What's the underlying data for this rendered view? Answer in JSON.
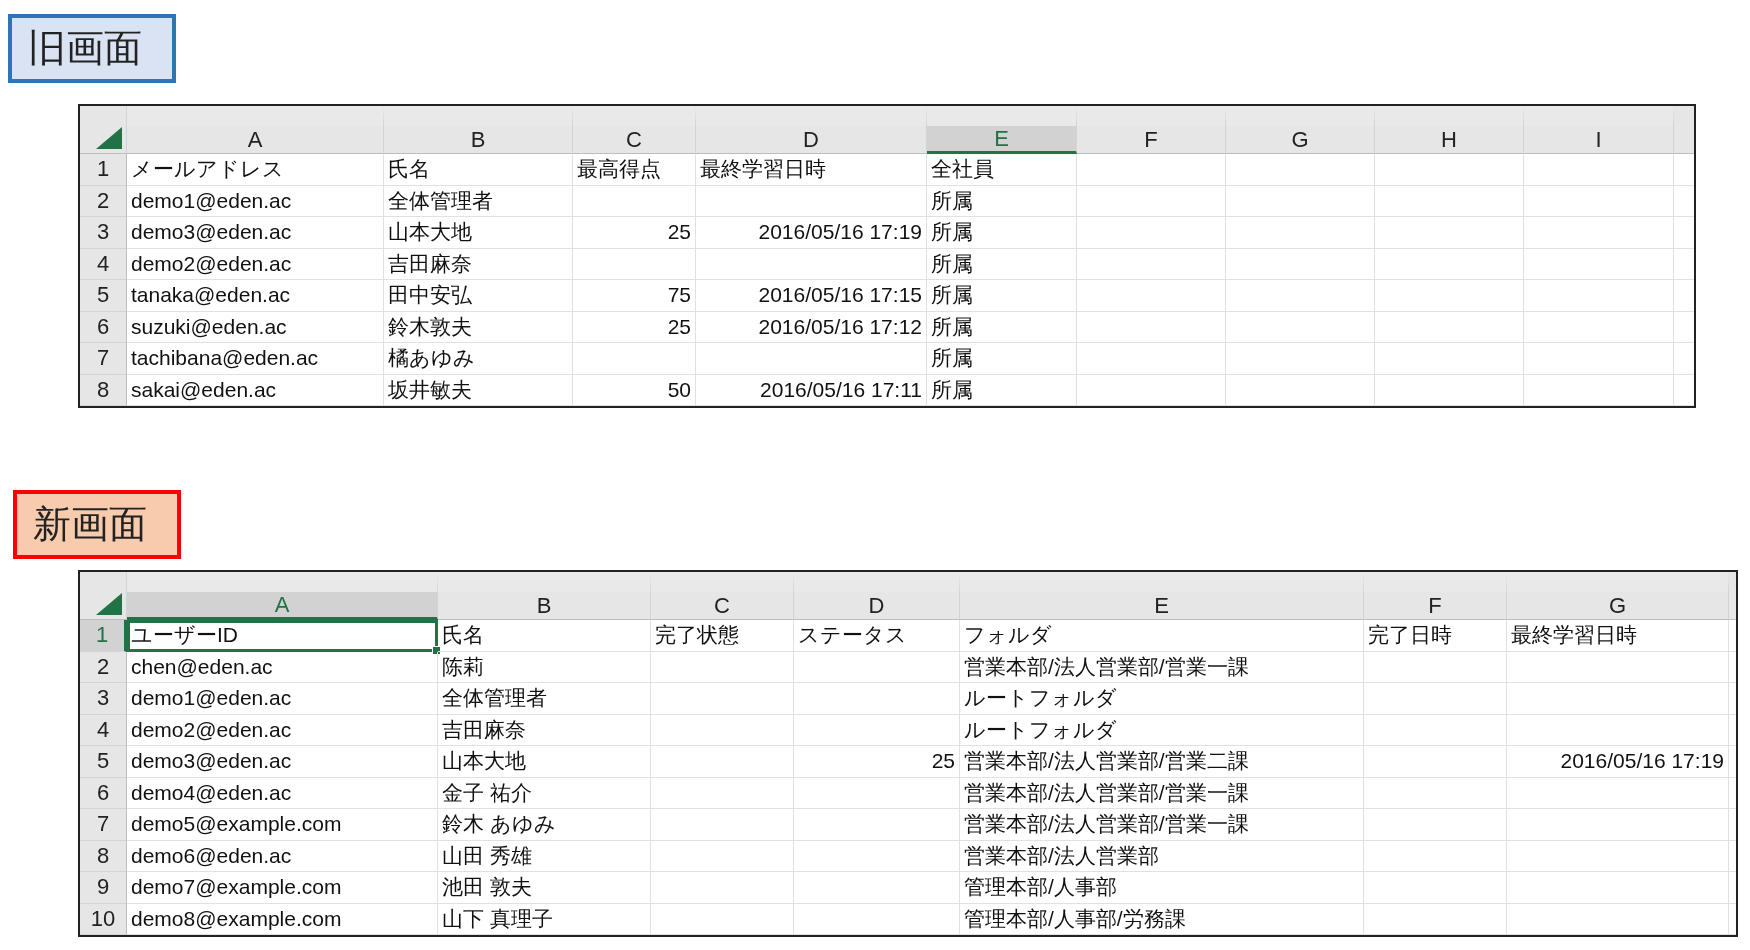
{
  "sheets": [
    {
      "label": "旧画面",
      "kind": "old",
      "columns": [
        {
          "letter": "A",
          "selected": false
        },
        {
          "letter": "B",
          "selected": false
        },
        {
          "letter": "C",
          "selected": false
        },
        {
          "letter": "D",
          "selected": false
        },
        {
          "letter": "E",
          "selected": true
        },
        {
          "letter": "F",
          "selected": false
        },
        {
          "letter": "G",
          "selected": false
        },
        {
          "letter": "H",
          "selected": false
        },
        {
          "letter": "I",
          "selected": false
        }
      ],
      "rows": [
        {
          "number": "1",
          "selected": false,
          "cells": [
            {
              "text": "メールアドレス",
              "kind": "text"
            },
            {
              "text": "氏名",
              "kind": "text"
            },
            {
              "text": "最高得点",
              "kind": "text"
            },
            {
              "text": "最終学習日時",
              "kind": "text"
            },
            {
              "text": "全社員",
              "kind": "text"
            },
            null,
            null,
            null,
            null
          ]
        },
        {
          "number": "2",
          "selected": false,
          "cells": [
            {
              "text": "demo1@eden.ac",
              "kind": "text"
            },
            {
              "text": "全体管理者",
              "kind": "text"
            },
            null,
            null,
            {
              "text": "所属",
              "kind": "text"
            },
            null,
            null,
            null,
            null
          ]
        },
        {
          "number": "3",
          "selected": false,
          "cells": [
            {
              "text": "demo3@eden.ac",
              "kind": "text"
            },
            {
              "text": "山本大地",
              "kind": "text"
            },
            {
              "text": "25",
              "kind": "number"
            },
            {
              "text": "2016/05/16 17:19",
              "kind": "number"
            },
            {
              "text": "所属",
              "kind": "text"
            },
            null,
            null,
            null,
            null
          ]
        },
        {
          "number": "4",
          "selected": false,
          "cells": [
            {
              "text": "demo2@eden.ac",
              "kind": "text"
            },
            {
              "text": "吉田麻奈",
              "kind": "text"
            },
            null,
            null,
            {
              "text": "所属",
              "kind": "text"
            },
            null,
            null,
            null,
            null
          ]
        },
        {
          "number": "5",
          "selected": false,
          "cells": [
            {
              "text": "tanaka@eden.ac",
              "kind": "text"
            },
            {
              "text": "田中安弘",
              "kind": "text"
            },
            {
              "text": "75",
              "kind": "number"
            },
            {
              "text": "2016/05/16 17:15",
              "kind": "number"
            },
            {
              "text": "所属",
              "kind": "text"
            },
            null,
            null,
            null,
            null
          ]
        },
        {
          "number": "6",
          "selected": false,
          "cells": [
            {
              "text": "suzuki@eden.ac",
              "kind": "text"
            },
            {
              "text": "鈴木敦夫",
              "kind": "text"
            },
            {
              "text": "25",
              "kind": "number"
            },
            {
              "text": "2016/05/16 17:12",
              "kind": "number"
            },
            {
              "text": "所属",
              "kind": "text"
            },
            null,
            null,
            null,
            null
          ]
        },
        {
          "number": "7",
          "selected": false,
          "cells": [
            {
              "text": "tachibana@eden.ac",
              "kind": "text"
            },
            {
              "text": "橘あゆみ",
              "kind": "text"
            },
            null,
            null,
            {
              "text": "所属",
              "kind": "text"
            },
            null,
            null,
            null,
            null
          ]
        },
        {
          "number": "8",
          "selected": false,
          "cells": [
            {
              "text": "sakai@eden.ac",
              "kind": "text"
            },
            {
              "text": "坂井敏夫",
              "kind": "text"
            },
            {
              "text": "50",
              "kind": "number"
            },
            {
              "text": "2016/05/16 17:11",
              "kind": "number"
            },
            {
              "text": "所属",
              "kind": "text"
            },
            null,
            null,
            null,
            null
          ]
        }
      ]
    },
    {
      "label": "新画面",
      "kind": "new",
      "columns": [
        {
          "letter": "A",
          "selected": true
        },
        {
          "letter": "B",
          "selected": false
        },
        {
          "letter": "C",
          "selected": false
        },
        {
          "letter": "D",
          "selected": false
        },
        {
          "letter": "E",
          "selected": false
        },
        {
          "letter": "F",
          "selected": false
        },
        {
          "letter": "G",
          "selected": false
        }
      ],
      "rows": [
        {
          "number": "1",
          "selected": true,
          "cells": [
            {
              "text": "ユーザーID",
              "kind": "text"
            },
            {
              "text": "氏名",
              "kind": "text"
            },
            {
              "text": "完了状態",
              "kind": "text"
            },
            {
              "text": "ステータス",
              "kind": "text"
            },
            {
              "text": "フォルダ",
              "kind": "text"
            },
            {
              "text": "完了日時",
              "kind": "text"
            },
            {
              "text": "最終学習日時",
              "kind": "text"
            }
          ]
        },
        {
          "number": "2",
          "selected": false,
          "cells": [
            {
              "text": "chen@eden.ac",
              "kind": "text"
            },
            {
              "text": "陈莉",
              "kind": "text"
            },
            null,
            null,
            {
              "text": "営業本部/法人営業部/営業一課",
              "kind": "text"
            },
            null,
            null
          ]
        },
        {
          "number": "3",
          "selected": false,
          "cells": [
            {
              "text": "demo1@eden.ac",
              "kind": "text"
            },
            {
              "text": "全体管理者",
              "kind": "text"
            },
            null,
            null,
            {
              "text": "ルートフォルダ",
              "kind": "text"
            },
            null,
            null
          ]
        },
        {
          "number": "4",
          "selected": false,
          "cells": [
            {
              "text": "demo2@eden.ac",
              "kind": "text"
            },
            {
              "text": "吉田麻奈",
              "kind": "text"
            },
            null,
            null,
            {
              "text": "ルートフォルダ",
              "kind": "text"
            },
            null,
            null
          ]
        },
        {
          "number": "5",
          "selected": false,
          "cells": [
            {
              "text": "demo3@eden.ac",
              "kind": "text"
            },
            {
              "text": "山本大地",
              "kind": "text"
            },
            null,
            {
              "text": "25",
              "kind": "number"
            },
            {
              "text": "営業本部/法人営業部/営業二課",
              "kind": "text"
            },
            null,
            {
              "text": "2016/05/16 17:19",
              "kind": "number"
            }
          ]
        },
        {
          "number": "6",
          "selected": false,
          "cells": [
            {
              "text": "demo4@eden.ac",
              "kind": "text"
            },
            {
              "text": "金子 祐介",
              "kind": "text"
            },
            null,
            null,
            {
              "text": "営業本部/法人営業部/営業一課",
              "kind": "text"
            },
            null,
            null
          ]
        },
        {
          "number": "7",
          "selected": false,
          "cells": [
            {
              "text": "demo5@example.com",
              "kind": "text"
            },
            {
              "text": "鈴木 あゆみ",
              "kind": "text"
            },
            null,
            null,
            {
              "text": "営業本部/法人営業部/営業一課",
              "kind": "text"
            },
            null,
            null
          ]
        },
        {
          "number": "8",
          "selected": false,
          "cells": [
            {
              "text": "demo6@eden.ac",
              "kind": "text"
            },
            {
              "text": "山田 秀雄",
              "kind": "text"
            },
            null,
            null,
            {
              "text": "営業本部/法人営業部",
              "kind": "text"
            },
            null,
            null
          ]
        },
        {
          "number": "9",
          "selected": false,
          "cells": [
            {
              "text": "demo7@example.com",
              "kind": "text"
            },
            {
              "text": "池田 敦夫",
              "kind": "text"
            },
            null,
            null,
            {
              "text": "管理本部/人事部",
              "kind": "text"
            },
            null,
            null
          ]
        },
        {
          "number": "10",
          "selected": false,
          "cells": [
            {
              "text": "demo8@example.com",
              "kind": "text"
            },
            {
              "text": "山下 真理子",
              "kind": "text"
            },
            null,
            null,
            {
              "text": "管理本部/人事部/労務課",
              "kind": "text"
            },
            null,
            null
          ]
        }
      ]
    }
  ]
}
